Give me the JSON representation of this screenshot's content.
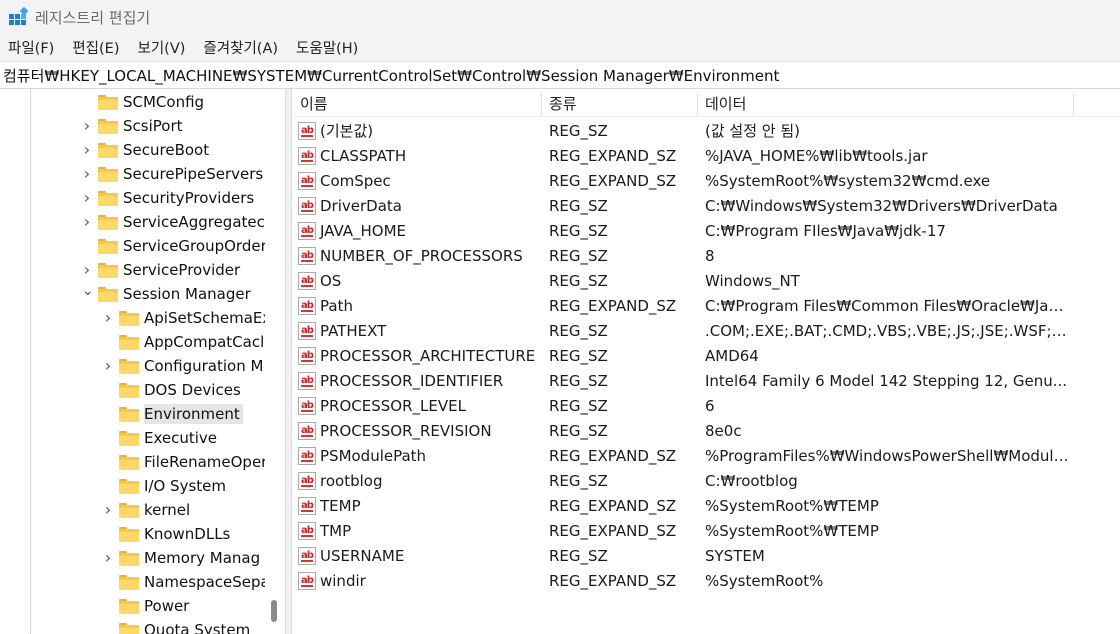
{
  "window": {
    "title": "레지스트리 편집기",
    "icon": "registry-editor-icon"
  },
  "menu": [
    {
      "label": "파일(F)"
    },
    {
      "label": "편집(E)"
    },
    {
      "label": "보기(V)"
    },
    {
      "label": "즐겨찾기(A)"
    },
    {
      "label": "도움말(H)"
    }
  ],
  "address": "컴퓨터₩HKEY_LOCAL_MACHINE₩SYSTEM₩CurrentControlSet₩Control₩Session Manager₩Environment",
  "tree": [
    {
      "label": "SCMConfig",
      "level": 0,
      "expand": "none"
    },
    {
      "label": "ScsiPort",
      "level": 0,
      "expand": "collapsed"
    },
    {
      "label": "SecureBoot",
      "level": 0,
      "expand": "collapsed"
    },
    {
      "label": "SecurePipeServers",
      "level": 0,
      "expand": "collapsed"
    },
    {
      "label": "SecurityProviders",
      "level": 0,
      "expand": "collapsed"
    },
    {
      "label": "ServiceAggregatec",
      "level": 0,
      "expand": "collapsed"
    },
    {
      "label": "ServiceGroupOrder",
      "level": 0,
      "expand": "none"
    },
    {
      "label": "ServiceProvider",
      "level": 0,
      "expand": "collapsed"
    },
    {
      "label": "Session Manager",
      "level": 0,
      "expand": "expanded"
    },
    {
      "label": "ApiSetSchemaEx",
      "level": 1,
      "expand": "collapsed"
    },
    {
      "label": "AppCompatCacl",
      "level": 1,
      "expand": "none"
    },
    {
      "label": "Configuration M",
      "level": 1,
      "expand": "collapsed"
    },
    {
      "label": "DOS Devices",
      "level": 1,
      "expand": "none"
    },
    {
      "label": "Environment",
      "level": 1,
      "expand": "none",
      "selected": true
    },
    {
      "label": "Executive",
      "level": 1,
      "expand": "none"
    },
    {
      "label": "FileRenameOper",
      "level": 1,
      "expand": "none"
    },
    {
      "label": "I/O System",
      "level": 1,
      "expand": "none"
    },
    {
      "label": "kernel",
      "level": 1,
      "expand": "collapsed"
    },
    {
      "label": "KnownDLLs",
      "level": 1,
      "expand": "none"
    },
    {
      "label": "Memory Manag",
      "level": 1,
      "expand": "collapsed"
    },
    {
      "label": "NamespaceSepa",
      "level": 1,
      "expand": "none"
    },
    {
      "label": "Power",
      "level": 1,
      "expand": "none"
    },
    {
      "label": "Quota System",
      "level": 1,
      "expand": "none"
    }
  ],
  "columns": {
    "name": "이름",
    "type": "종류",
    "data": "데이터"
  },
  "values": [
    {
      "name": "(기본값)",
      "type": "REG_SZ",
      "data": "(값 설정 안 됨)"
    },
    {
      "name": "CLASSPATH",
      "type": "REG_EXPAND_SZ",
      "data": "%JAVA_HOME%₩lib₩tools.jar"
    },
    {
      "name": "ComSpec",
      "type": "REG_EXPAND_SZ",
      "data": "%SystemRoot%₩system32₩cmd.exe"
    },
    {
      "name": "DriverData",
      "type": "REG_SZ",
      "data": "C:₩Windows₩System32₩Drivers₩DriverData"
    },
    {
      "name": "JAVA_HOME",
      "type": "REG_SZ",
      "data": "C:₩Program FIles₩Java₩jdk-17"
    },
    {
      "name": "NUMBER_OF_PROCESSORS",
      "type": "REG_SZ",
      "data": "8"
    },
    {
      "name": "OS",
      "type": "REG_SZ",
      "data": "Windows_NT"
    },
    {
      "name": "Path",
      "type": "REG_EXPAND_SZ",
      "data": "C:₩Program Files₩Common Files₩Oracle₩Java..."
    },
    {
      "name": "PATHEXT",
      "type": "REG_SZ",
      "data": ".COM;.EXE;.BAT;.CMD;.VBS;.VBE;.JS;.JSE;.WSF;.W..."
    },
    {
      "name": "PROCESSOR_ARCHITECTURE",
      "type": "REG_SZ",
      "data": "AMD64"
    },
    {
      "name": "PROCESSOR_IDENTIFIER",
      "type": "REG_SZ",
      "data": "Intel64 Family 6 Model 142 Stepping 12, Genu..."
    },
    {
      "name": "PROCESSOR_LEVEL",
      "type": "REG_SZ",
      "data": "6"
    },
    {
      "name": "PROCESSOR_REVISION",
      "type": "REG_SZ",
      "data": "8e0c"
    },
    {
      "name": "PSModulePath",
      "type": "REG_EXPAND_SZ",
      "data": "%ProgramFiles%₩WindowsPowerShell₩Module..."
    },
    {
      "name": "rootblog",
      "type": "REG_SZ",
      "data": "C:₩rootblog"
    },
    {
      "name": "TEMP",
      "type": "REG_EXPAND_SZ",
      "data": "%SystemRoot%₩TEMP"
    },
    {
      "name": "TMP",
      "type": "REG_EXPAND_SZ",
      "data": "%SystemRoot%₩TEMP"
    },
    {
      "name": "USERNAME",
      "type": "REG_SZ",
      "data": "SYSTEM"
    },
    {
      "name": "windir",
      "type": "REG_EXPAND_SZ",
      "data": "%SystemRoot%"
    }
  ],
  "value_icon": "ab-string-icon",
  "colors": {
    "folder": "#f6c94c",
    "selection": "#e5e5e5",
    "chrome": "#f3f3f3",
    "string_icon": "#cc2222"
  }
}
